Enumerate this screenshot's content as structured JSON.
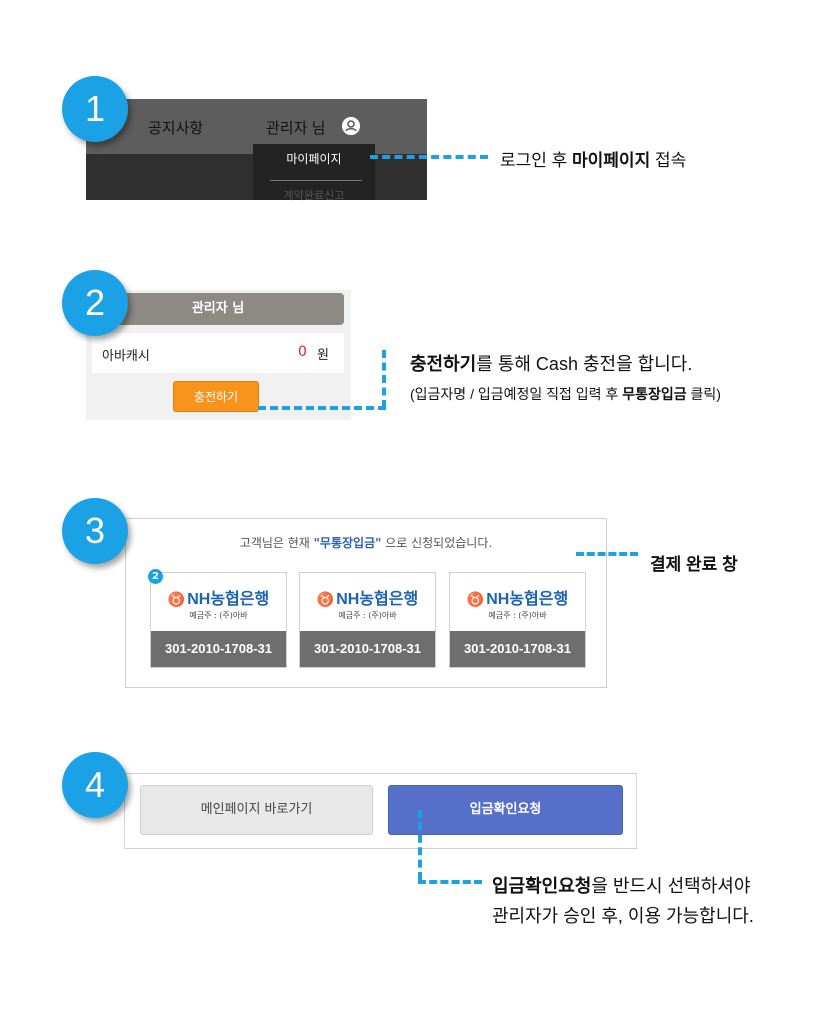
{
  "steps": [
    "1",
    "2",
    "3",
    "4"
  ],
  "step1": {
    "nav_notice": "공지사항",
    "nav_admin": "관리자 님",
    "user_icon": "user-circle-icon",
    "dropdown_mypage": "마이페이지",
    "dropdown_next": "계약완료신고",
    "caption_pre": "로그인 후 ",
    "caption_bold": "마이페이지",
    "caption_post": " 접속"
  },
  "step2": {
    "header": "관리자 님",
    "cash_label": "아바캐시",
    "cash_value": "0",
    "cash_unit": "원",
    "charge_button": "충전하기",
    "caption_bold": "충전하기",
    "caption_post": "를 통해 Cash 충전을 합니다.",
    "sub_pre": "(입금자명 / 입금예정일 직접 입력 후 ",
    "sub_bold": "무통장입금",
    "sub_post": " 클릭)"
  },
  "step3": {
    "msg_pre": "고객님은 현재 ",
    "msg_bold": "\"무통장입금\"",
    "msg_post": " 으로 신청되었습니다.",
    "card_badge": "2",
    "cards": [
      {
        "bank": "NH농협은행",
        "holder": "예금주 : (주)아바",
        "account": "301-2010-1708-31"
      },
      {
        "bank": "NH농협은행",
        "holder": "예금주 : (주)아바",
        "account": "301-2010-1708-31"
      },
      {
        "bank": "NH농협은행",
        "holder": "예금주 : (주)아바",
        "account": "301-2010-1708-31"
      }
    ],
    "caption": "결제 완료 창"
  },
  "step4": {
    "main_button": "메인페이지 바로가기",
    "confirm_button": "입금확인요청",
    "caption_bold": "입금확인요청",
    "caption_post": "을 반드시 선택하셔야",
    "caption_line2": "관리자가 승인 후, 이용 가능합니다."
  },
  "colors": {
    "accent": "#1aa1e6",
    "charge_button": "#f7941d",
    "confirm_button": "#5670c9",
    "nh_blue": "#1b64b5",
    "nh_yellow": "#f2a900",
    "cash_red": "#e02020"
  }
}
